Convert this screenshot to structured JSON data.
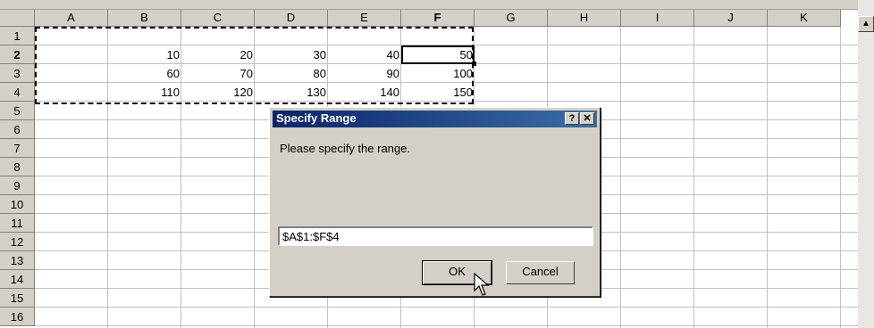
{
  "sheet": {
    "columns": [
      "A",
      "B",
      "C",
      "D",
      "E",
      "F",
      "G",
      "H",
      "I",
      "J",
      "K"
    ],
    "active_column": "F",
    "rows": [
      "1",
      "2",
      "3",
      "4",
      "5",
      "6",
      "7",
      "8",
      "9",
      "10",
      "11",
      "12",
      "13",
      "14",
      "15",
      "16"
    ],
    "active_row": "2",
    "values": [
      {
        "ref": "B2",
        "value": "10"
      },
      {
        "ref": "C2",
        "value": "20"
      },
      {
        "ref": "D2",
        "value": "30"
      },
      {
        "ref": "E2",
        "value": "40"
      },
      {
        "ref": "F2",
        "value": "50"
      },
      {
        "ref": "B3",
        "value": "60"
      },
      {
        "ref": "C3",
        "value": "70"
      },
      {
        "ref": "D3",
        "value": "80"
      },
      {
        "ref": "E3",
        "value": "90"
      },
      {
        "ref": "F3",
        "value": "100"
      },
      {
        "ref": "B4",
        "value": "110"
      },
      {
        "ref": "C4",
        "value": "120"
      },
      {
        "ref": "D4",
        "value": "130"
      },
      {
        "ref": "E4",
        "value": "140"
      },
      {
        "ref": "F4",
        "value": "150"
      }
    ]
  },
  "dialog": {
    "title": "Specify Range",
    "help_label": "?",
    "close_label": "✕",
    "prompt": "Please specify the range.",
    "range_value": "$A$1:$F$4",
    "ok_label": "OK",
    "cancel_label": "Cancel"
  },
  "scrollbar": {
    "up_arrow": "▲"
  }
}
